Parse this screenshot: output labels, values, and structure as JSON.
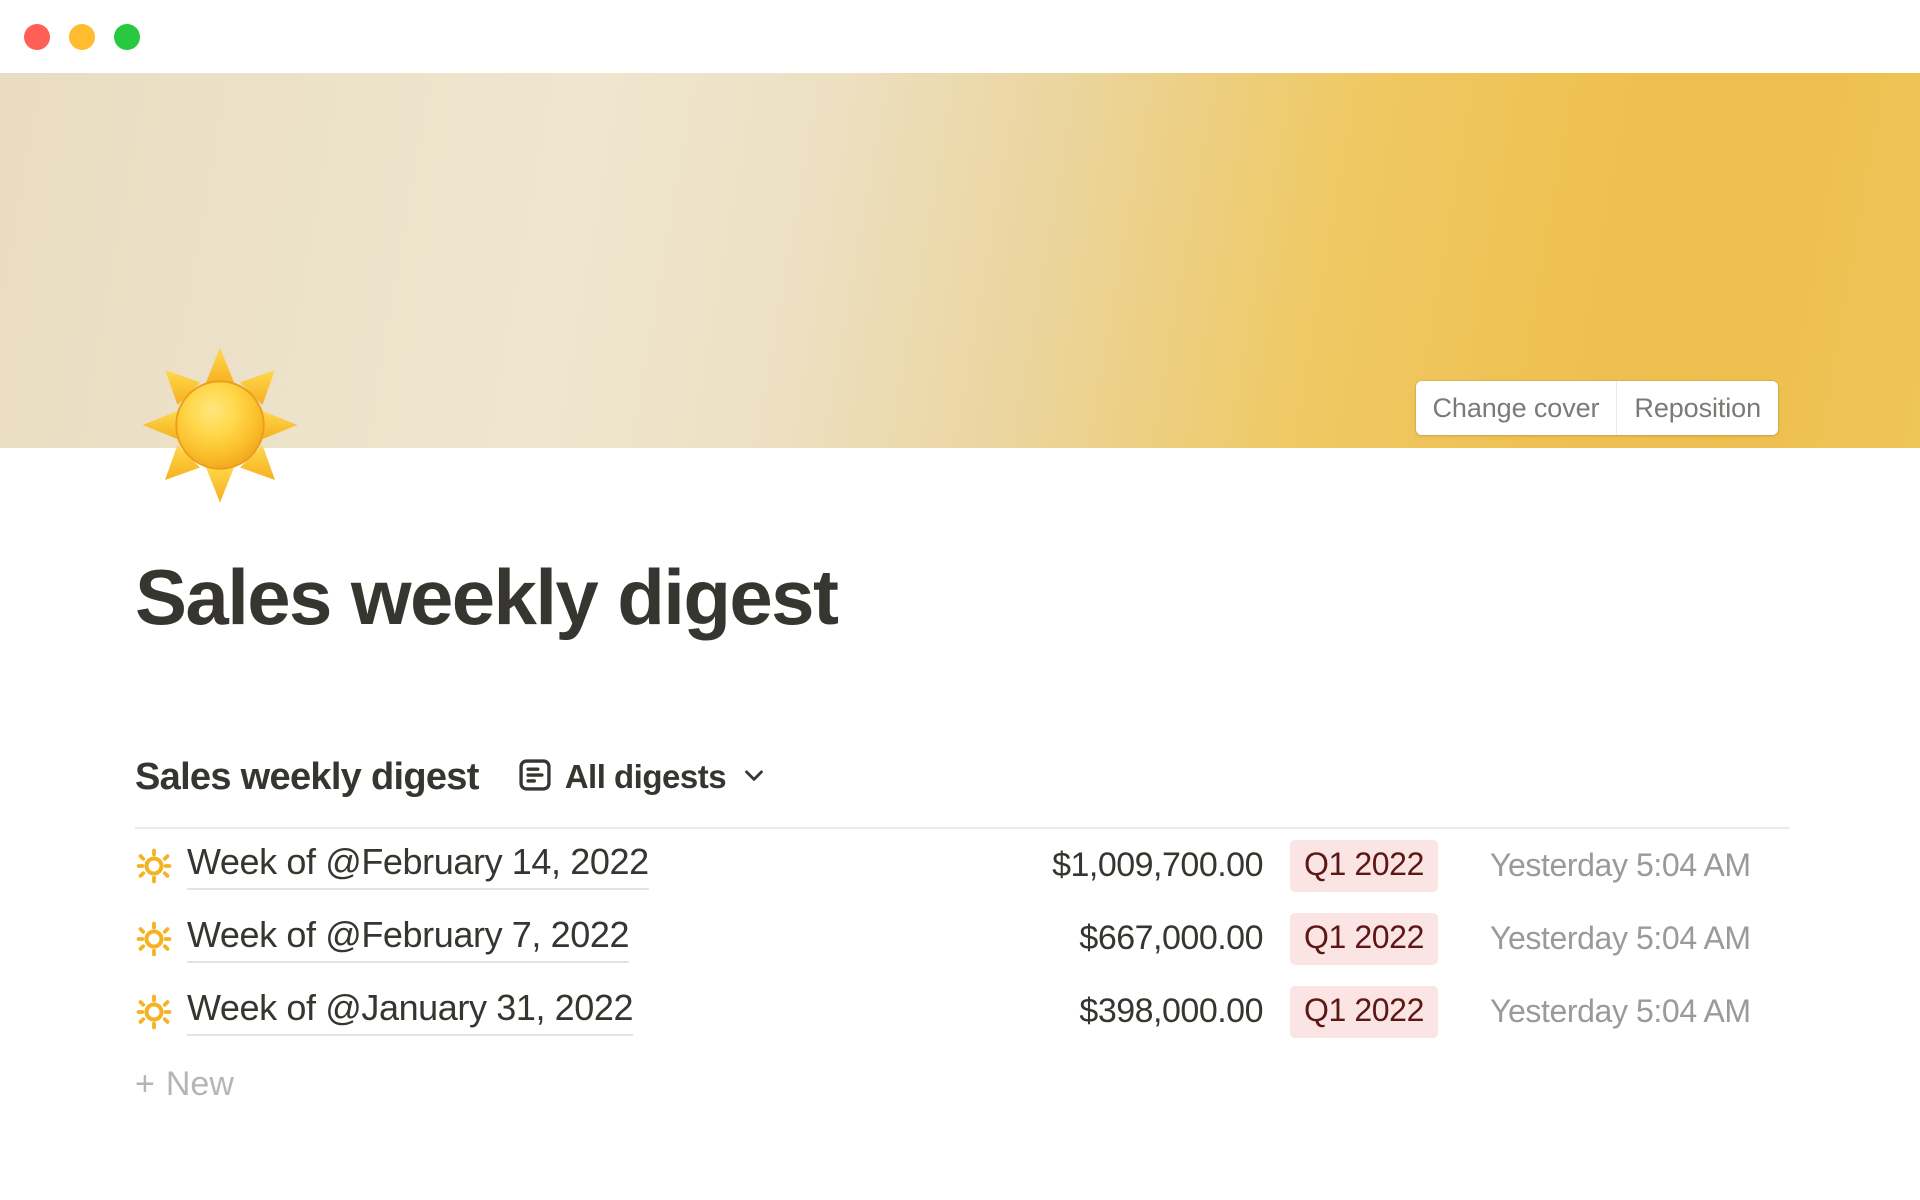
{
  "window": {
    "traffic_lights": [
      {
        "name": "close",
        "color": "#FF5F57"
      },
      {
        "name": "minimize",
        "color": "#FEBC2E"
      },
      {
        "name": "maximize",
        "color": "#28C840"
      }
    ]
  },
  "cover": {
    "gradient_from": "#E9DCC0",
    "gradient_to": "#EFC458",
    "buttons": [
      {
        "id": "change-cover",
        "label": "Change cover"
      },
      {
        "id": "reposition",
        "label": "Reposition"
      }
    ]
  },
  "page": {
    "icon": "sun-emoji",
    "title": "Sales weekly digest"
  },
  "database": {
    "title": "Sales weekly digest",
    "view_icon": "list-view-icon",
    "view_label": "All digests",
    "chevron": "chevron-down-icon",
    "new_label": "New",
    "badge_bg": "#FBE4E4",
    "badge_color": "#5D1715",
    "rows": [
      {
        "emoji": "bright-sun-icon",
        "title": "Week of @February 14, 2022",
        "amount": "$1,009,700.00",
        "badge": "Q1 2022",
        "time": "Yesterday 5:04 AM"
      },
      {
        "emoji": "bright-sun-icon",
        "title": "Week of @February 7, 2022",
        "amount": "$667,000.00",
        "badge": "Q1 2022",
        "time": "Yesterday 5:04 AM"
      },
      {
        "emoji": "bright-sun-icon",
        "title": "Week of @January 31, 2022",
        "amount": "$398,000.00",
        "badge": "Q1 2022",
        "time": "Yesterday 5:04 AM"
      }
    ]
  }
}
